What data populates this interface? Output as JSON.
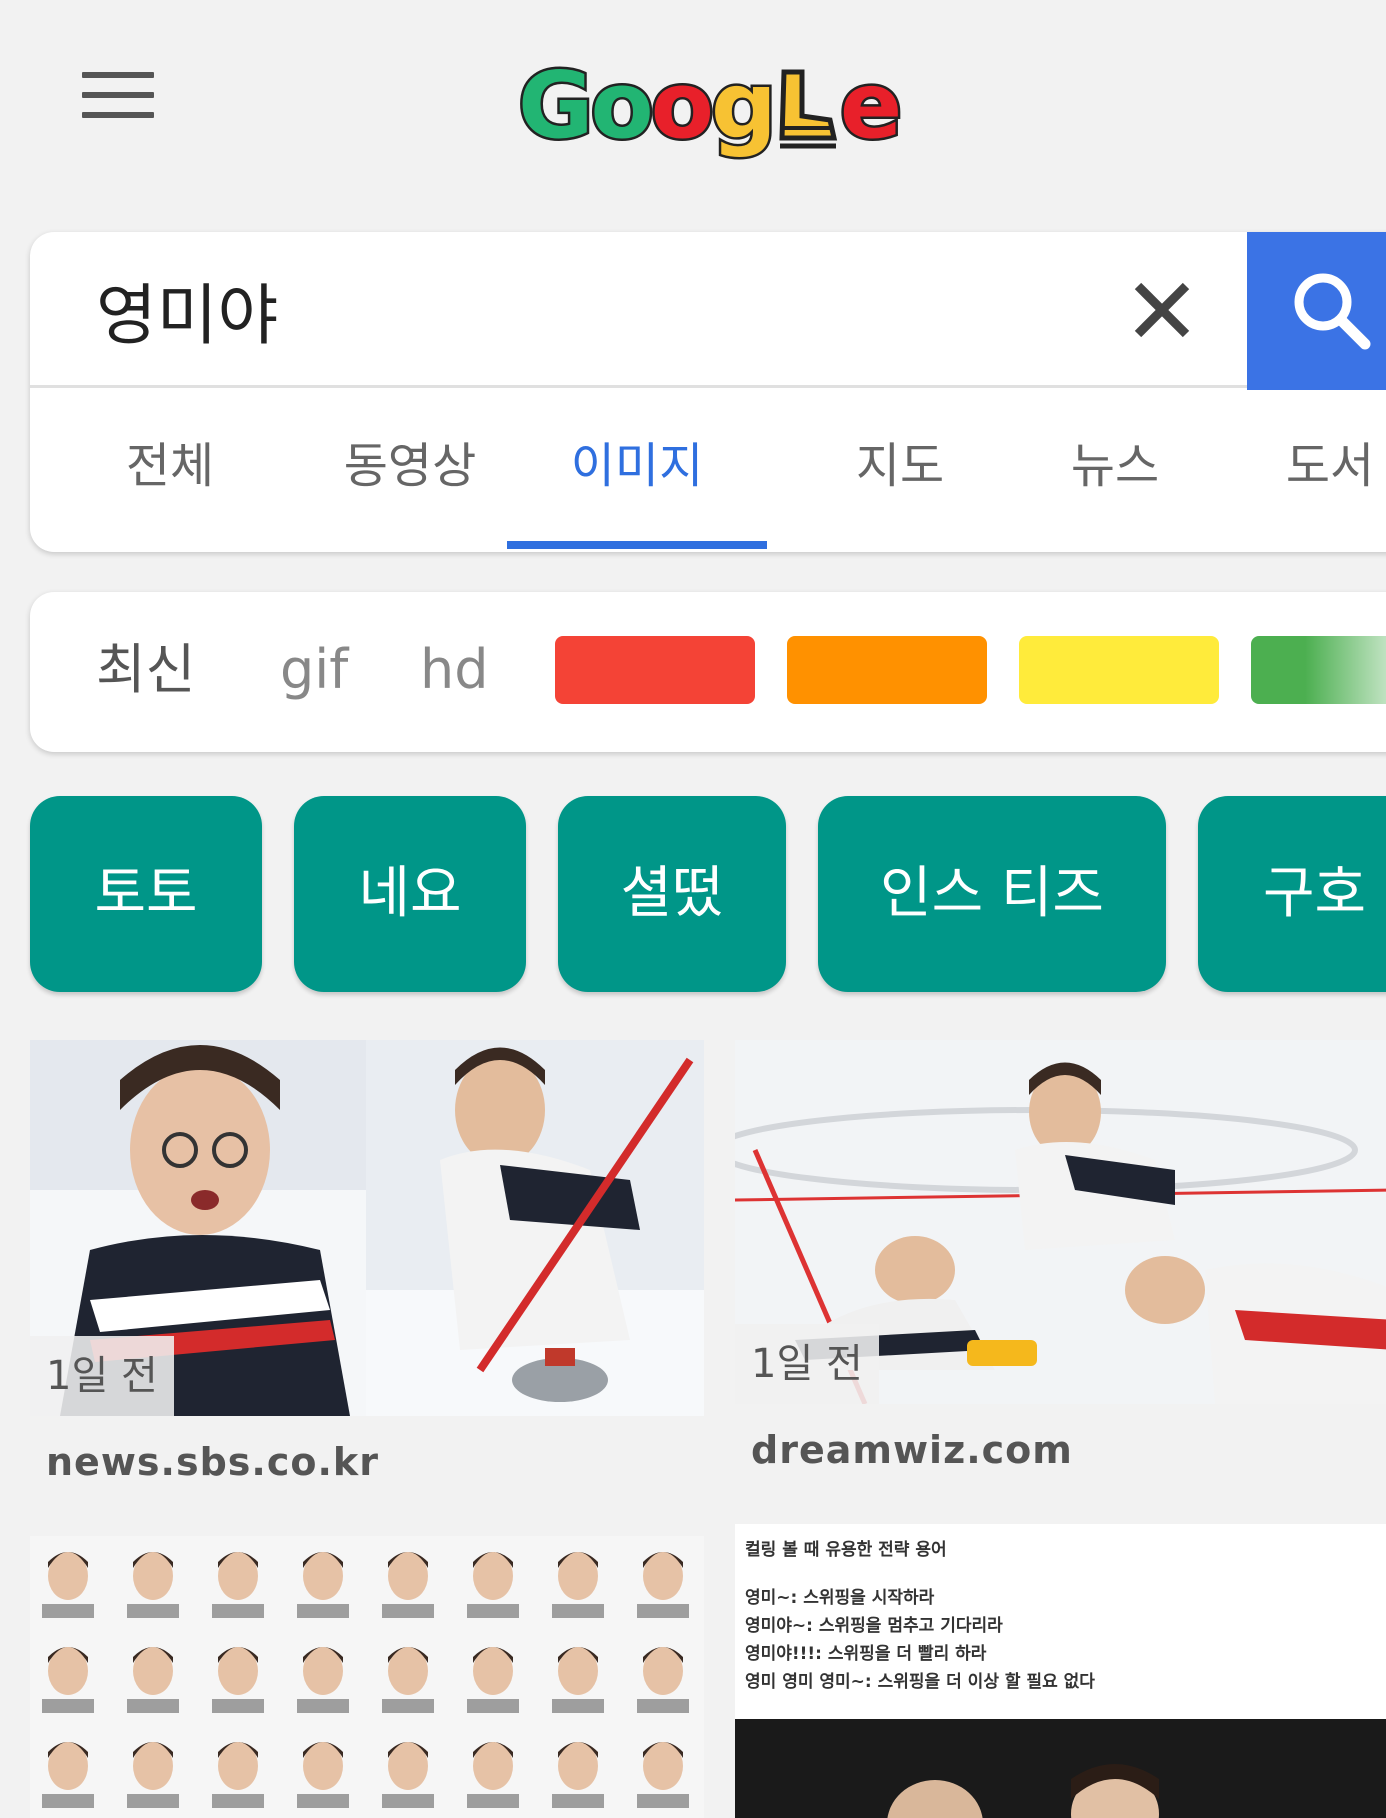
{
  "header": {
    "menu_icon": "hamburger-menu-icon",
    "logo_letters": [
      {
        "char": "G",
        "color": "#22b573"
      },
      {
        "char": "o",
        "color": "#22b573"
      },
      {
        "char": "o",
        "color": "#e8202a"
      },
      {
        "char": "g",
        "color": "#f7c233"
      },
      {
        "char": "l",
        "color": "#f7c233"
      },
      {
        "char": "e",
        "color": "#e8202a"
      }
    ]
  },
  "search": {
    "query": "영미야",
    "clear_icon": "close-icon",
    "search_icon": "search-icon",
    "accent_color": "#3b73e5"
  },
  "tabs": [
    {
      "label": "전체",
      "active": false
    },
    {
      "label": "동영상",
      "active": false
    },
    {
      "label": "이미지",
      "active": true
    },
    {
      "label": "지도",
      "active": false
    },
    {
      "label": "뉴스",
      "active": false
    },
    {
      "label": "도서",
      "active": false
    }
  ],
  "filters": {
    "latest": "최신",
    "gif": "gif",
    "hd": "hd",
    "colors": [
      "#f44336",
      "#ff9100",
      "#ffeb3b",
      "#4caf50"
    ]
  },
  "chips": [
    "토토",
    "네요",
    "셜떴",
    "인스 티즈",
    "구호"
  ],
  "results": [
    {
      "badge": "1일 전",
      "source": "news.sbs.co.kr"
    },
    {
      "badge": "1일 전",
      "source": "dreamwiz.com"
    },
    {
      "badge": "",
      "source": ""
    },
    {
      "badge": "",
      "source": "",
      "notes": [
        "컬링 볼 때 유용한 전략 용어",
        "영미~: 스위핑을 시작하라",
        "영미야~: 스위핑을 멈추고 기다리라",
        "영미야!!!: 스위핑을 더 빨리 하라",
        "영미 영미 영미~: 스위핑을 더 이상 할 필요 없다"
      ]
    }
  ]
}
